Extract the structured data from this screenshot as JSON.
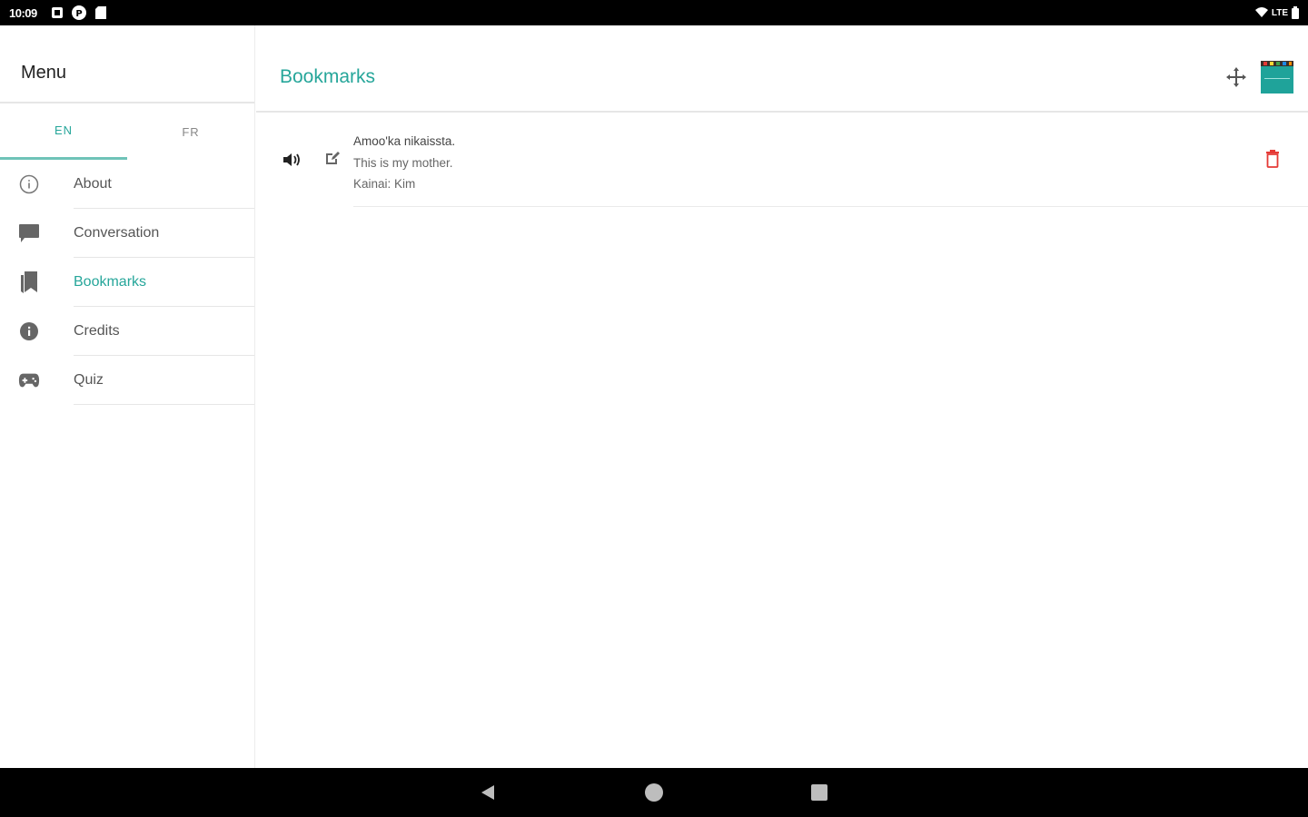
{
  "status_bar": {
    "time": "10:09",
    "network": "LTE"
  },
  "sidebar": {
    "title": "Menu",
    "tabs": [
      {
        "label": "EN",
        "active": true
      },
      {
        "label": "FR",
        "active": false
      }
    ],
    "items": [
      {
        "label": "About",
        "icon": "info-outline-icon",
        "active": false
      },
      {
        "label": "Conversation",
        "icon": "chat-bubble-icon",
        "active": false
      },
      {
        "label": "Bookmarks",
        "icon": "bookmarks-icon",
        "active": true
      },
      {
        "label": "Credits",
        "icon": "info-filled-icon",
        "active": false
      },
      {
        "label": "Quiz",
        "icon": "gamepad-icon",
        "active": false
      }
    ]
  },
  "header": {
    "title": "Bookmarks"
  },
  "bookmarks": [
    {
      "phrase": "Amoo'ka nikaissta.",
      "translation": "This is my mother.",
      "speaker": "Kainai: Kim"
    }
  ],
  "colors": {
    "accent": "#26a69a",
    "delete": "#e53935",
    "bar": "#000000"
  }
}
